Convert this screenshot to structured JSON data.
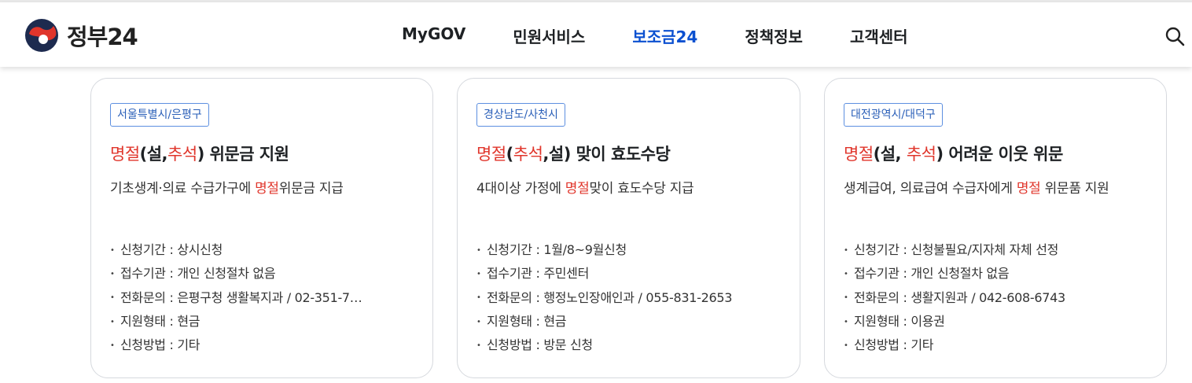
{
  "brand": {
    "name": "정부24",
    "accent": "#0b50d0",
    "highlight": "#e0352b"
  },
  "nav": [
    {
      "label": "MyGOV",
      "active": false
    },
    {
      "label": "민원서비스",
      "active": false
    },
    {
      "label": "보조금24",
      "active": true
    },
    {
      "label": "정책정보",
      "active": false
    },
    {
      "label": "고객센터",
      "active": false
    }
  ],
  "search_icon": "search-icon",
  "cards": [
    {
      "region": "서울특별시/은평구",
      "title": {
        "p1": "명절",
        "p2": "(설,",
        "p3": "추석",
        "p4": ") 위문금 지원"
      },
      "desc": {
        "a": "기초생계·의료 수급가구에 ",
        "b": "명절",
        "c": "위문금 지급"
      },
      "info": [
        "신청기간 : 상시신청",
        "접수기관 : 개인 신청절차 없음",
        "전화문의 : 은평구청 생활복지과 / 02-351-7…",
        "지원형태 : 현금",
        "신청방법 : 기타"
      ]
    },
    {
      "region": "경상남도/사천시",
      "title": {
        "p1": "명절",
        "p2": "(",
        "p3": "추석",
        "p4": ",설) 맞이 효도수당"
      },
      "desc": {
        "a": "4대이상 가정에 ",
        "b": "명절",
        "c": "맞이 효도수당 지급"
      },
      "info": [
        "신청기간 : 1월/8~9월신청",
        "접수기관 : 주민센터",
        "전화문의 : 행정노인장애인과 / 055-831-2653",
        "지원형태 : 현금",
        "신청방법 : 방문 신청"
      ]
    },
    {
      "region": "대전광역시/대덕구",
      "title": {
        "p1": "명절",
        "p2": "(설, ",
        "p3": "추석",
        "p4": ") 어려운 이웃 위문"
      },
      "desc": {
        "a": "생계급여, 의료급여 수급자에게 ",
        "b": "명절",
        "c": " 위문품 지원"
      },
      "info": [
        "신청기간 : 신청불필요/지자체 자체 선정",
        "접수기관 : 개인 신청절차 없음",
        "전화문의 : 생활지원과 / 042-608-6743",
        "지원형태 : 이용권",
        "신청방법 : 기타"
      ]
    }
  ]
}
